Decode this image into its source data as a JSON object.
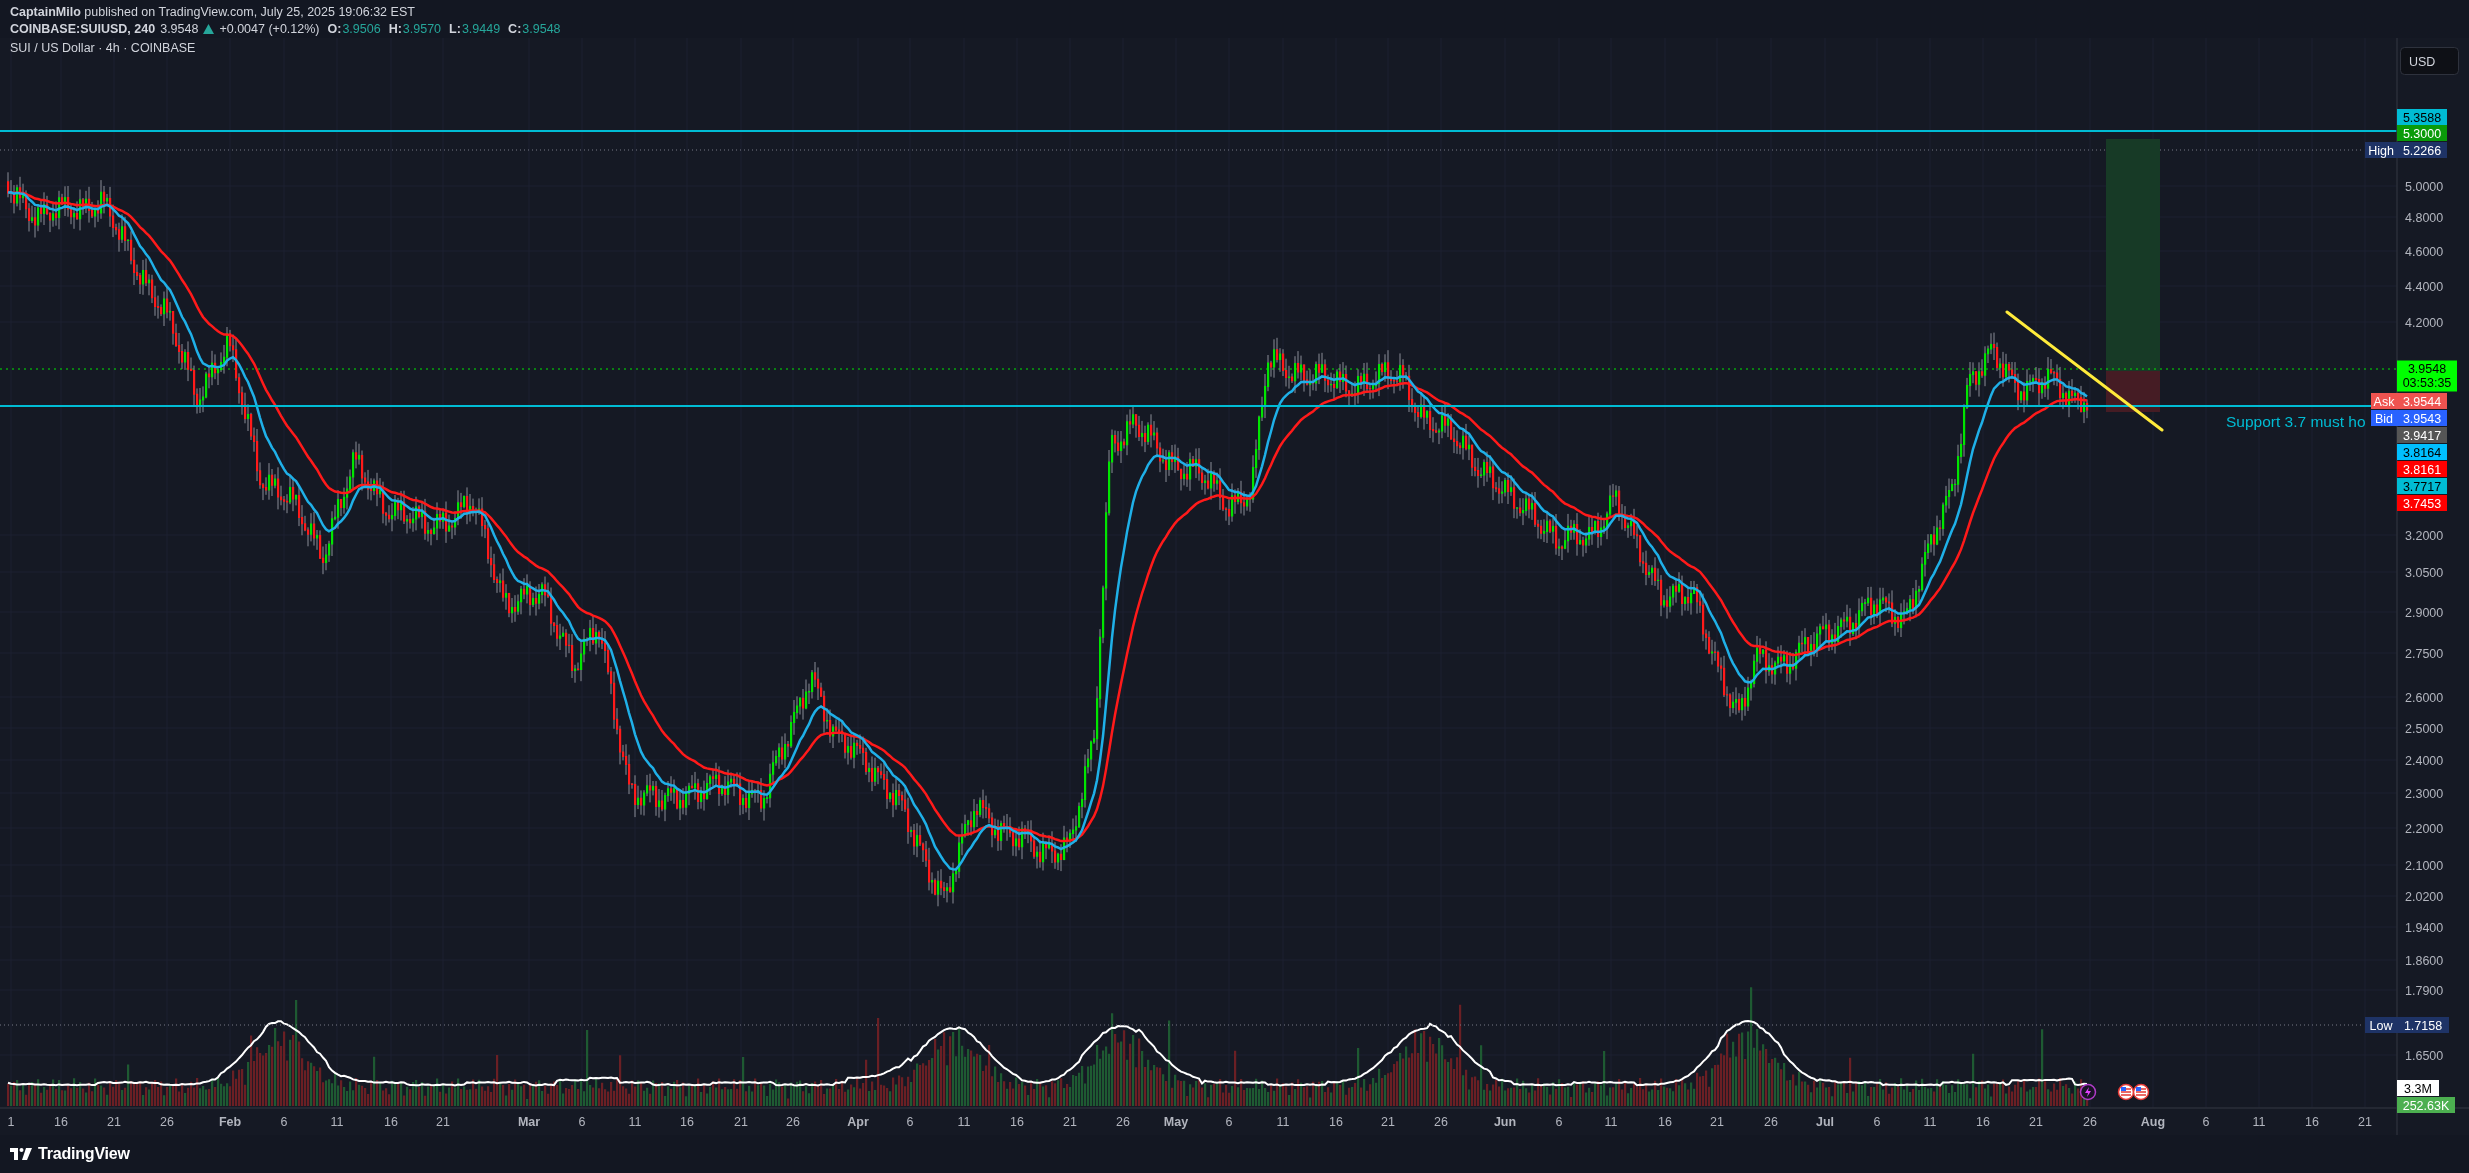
{
  "header": {
    "byline": "**CaptainMilo** published on TradingView.com, July 25, 2025 19:06:32 EST",
    "symbol": "COINBASE:SUIUSD, 240",
    "last": "3.9548",
    "rising": true,
    "change": "+0.0047 (+0.12%)",
    "ohlc": [
      {
        "label": "O:",
        "value": "3.9506"
      },
      {
        "label": "H:",
        "value": "3.9570"
      },
      {
        "label": "L:",
        "value": "3.9449"
      },
      {
        "label": "C:",
        "value": "3.9548"
      }
    ]
  },
  "chart": {
    "title": "SUI / US Dollar · 4h · COINBASE",
    "currency_button": "USD",
    "annotation": "Support 3.7 must ho",
    "price_ticks": [
      "5.0000",
      "4.8000",
      "4.6000",
      "4.4000",
      "4.2000",
      "3.2000",
      "3.0500",
      "2.9000",
      "2.7500",
      "2.6000",
      "2.5000",
      "2.4000",
      "2.3000",
      "2.2000",
      "2.1000",
      "2.0200",
      "1.9400",
      "1.8600",
      "1.7900",
      "1.6500"
    ],
    "price_tags": [
      {
        "text": "5.3588",
        "color": "#00bcd4",
        "dark_text": true
      },
      {
        "text": "5.3000",
        "color": "#0a9b0a",
        "dark_text": false
      },
      {
        "text": "5.2266",
        "color": "#1e3366",
        "dark_text": false
      },
      {
        "text": "3.9548",
        "countdown": "03:53:35",
        "color": "#00ff00",
        "dark_text": true
      },
      {
        "text": "3.9544",
        "color": "#ef5350",
        "dark_text": false
      },
      {
        "text": "3.9543",
        "color": "#2962ff",
        "dark_text": false
      },
      {
        "text": "3.9417",
        "color": "#555555",
        "dark_text": false
      },
      {
        "text": "3.8164",
        "color": "#00bfff",
        "dark_text": true
      },
      {
        "text": "3.8161",
        "color": "#ff0000",
        "dark_text": false
      },
      {
        "text": "3.7717",
        "color": "#00bcd4",
        "dark_text": true
      },
      {
        "text": "3.7453",
        "color": "#ff0000",
        "dark_text": false
      }
    ],
    "side_labels": [
      {
        "text": "High",
        "color": "#1e3366"
      },
      {
        "text": "Ask",
        "color": "#ef5350"
      },
      {
        "text": "Bid",
        "color": "#2962ff"
      },
      {
        "text": "Low",
        "color": "#1e3366"
      }
    ],
    "low_tag": {
      "text": "1.7158",
      "color": "#1e3366"
    },
    "volume_tags": [
      {
        "text": "3.3M",
        "color": "#ffffff",
        "dark_text": true
      },
      {
        "text": "252.63K",
        "color": "#4caf50",
        "dark_text": false
      }
    ],
    "time_ticks": [
      {
        "label": "1",
        "kind": "day"
      },
      {
        "label": "16",
        "kind": "day"
      },
      {
        "label": "21",
        "kind": "day"
      },
      {
        "label": "26",
        "kind": "day"
      },
      {
        "label": "Feb",
        "kind": "month"
      },
      {
        "label": "6",
        "kind": "day"
      },
      {
        "label": "11",
        "kind": "day"
      },
      {
        "label": "16",
        "kind": "day"
      },
      {
        "label": "21",
        "kind": "day"
      },
      {
        "label": "Mar",
        "kind": "month"
      },
      {
        "label": "6",
        "kind": "day"
      },
      {
        "label": "11",
        "kind": "day"
      },
      {
        "label": "16",
        "kind": "day"
      },
      {
        "label": "21",
        "kind": "day"
      },
      {
        "label": "26",
        "kind": "day"
      },
      {
        "label": "Apr",
        "kind": "month"
      },
      {
        "label": "6",
        "kind": "day"
      },
      {
        "label": "11",
        "kind": "day"
      },
      {
        "label": "16",
        "kind": "day"
      },
      {
        "label": "21",
        "kind": "day"
      },
      {
        "label": "26",
        "kind": "day"
      },
      {
        "label": "May",
        "kind": "month"
      },
      {
        "label": "6",
        "kind": "day"
      },
      {
        "label": "11",
        "kind": "day"
      },
      {
        "label": "16",
        "kind": "day"
      },
      {
        "label": "21",
        "kind": "day"
      },
      {
        "label": "26",
        "kind": "day"
      },
      {
        "label": "Jun",
        "kind": "month"
      },
      {
        "label": "6",
        "kind": "day"
      },
      {
        "label": "11",
        "kind": "day"
      },
      {
        "label": "16",
        "kind": "day"
      },
      {
        "label": "21",
        "kind": "day"
      },
      {
        "label": "26",
        "kind": "day"
      },
      {
        "label": "Jul",
        "kind": "month"
      },
      {
        "label": "6",
        "kind": "day"
      },
      {
        "label": "11",
        "kind": "day"
      },
      {
        "label": "16",
        "kind": "day"
      },
      {
        "label": "21",
        "kind": "day"
      },
      {
        "label": "26",
        "kind": "day"
      },
      {
        "label": "Aug",
        "kind": "month"
      },
      {
        "label": "6",
        "kind": "day"
      },
      {
        "label": "11",
        "kind": "day"
      },
      {
        "label": "16",
        "kind": "day"
      },
      {
        "label": "21",
        "kind": "day"
      }
    ]
  },
  "footer": {
    "logo": "TradingView"
  }
}
